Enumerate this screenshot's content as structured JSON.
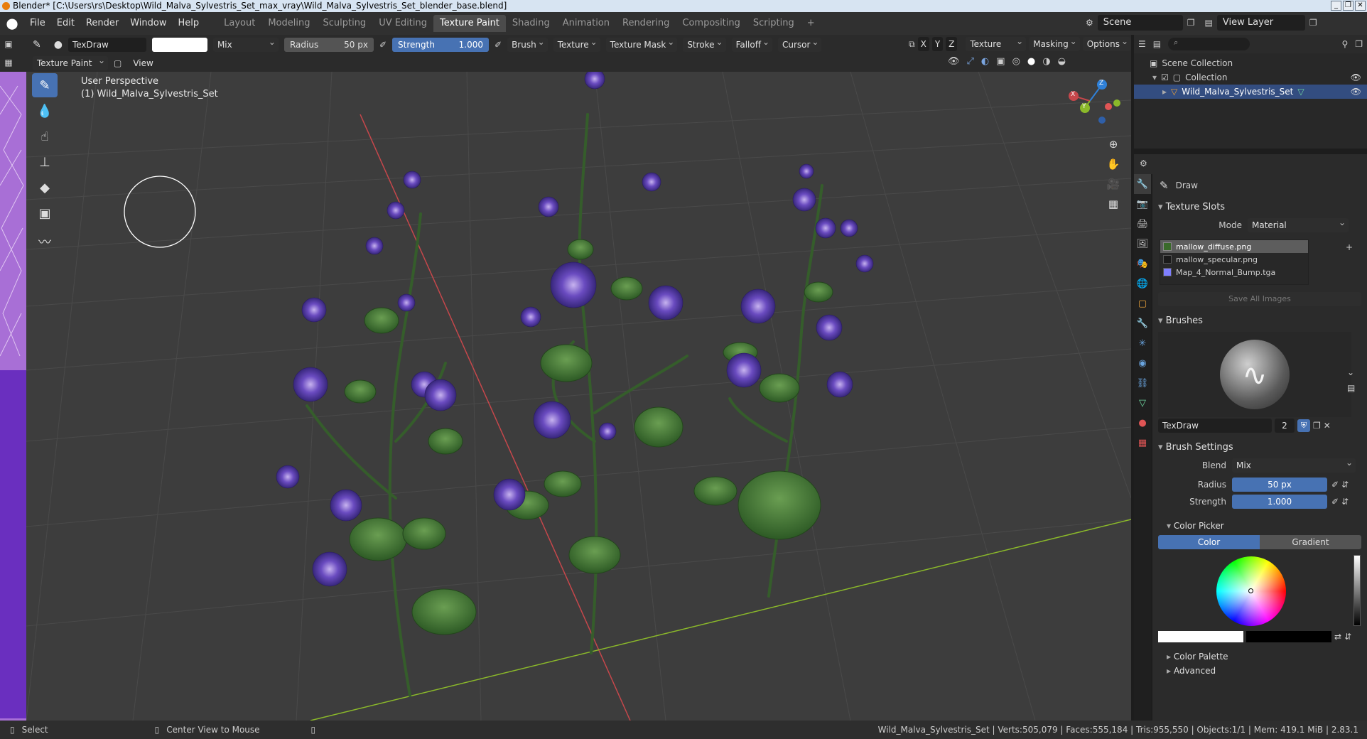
{
  "window": {
    "title": "Blender* [C:\\Users\\rs\\Desktop\\Wild_Malva_Sylvestris_Set_max_vray\\Wild_Malva_Sylvestris_Set_blender_base.blend]",
    "controls": [
      "_",
      "❐",
      "✕"
    ]
  },
  "menu": {
    "items": [
      "File",
      "Edit",
      "Render",
      "Window",
      "Help"
    ]
  },
  "workspaces": {
    "tabs": [
      "Layout",
      "Modeling",
      "Sculpting",
      "UV Editing",
      "Texture Paint",
      "Shading",
      "Animation",
      "Rendering",
      "Compositing",
      "Scripting"
    ],
    "active": "Texture Paint",
    "add": "+"
  },
  "topright": {
    "scene": "Scene",
    "view_layer": "View Layer"
  },
  "tool_header": {
    "brush_name": "TexDraw",
    "blend": "Mix",
    "radius_label": "Radius",
    "radius_value": "50 px",
    "strength_label": "Strength",
    "strength_value": "1.000",
    "menus": [
      "Brush",
      "Texture",
      "Texture Mask",
      "Stroke",
      "Falloff",
      "Cursor"
    ],
    "axes": [
      "X",
      "Y",
      "Z"
    ],
    "right_menus": [
      "Texture Slots",
      "Masking",
      "Options"
    ]
  },
  "view_header": {
    "mode": "Texture Paint",
    "view": "View"
  },
  "viewport": {
    "perspective": "User Perspective",
    "object": "(1) Wild_Malva_Sylvestris_Set",
    "gizmo_axes": [
      "X",
      "Y",
      "Z"
    ]
  },
  "outliner": {
    "root": "Scene Collection",
    "collection": "Collection",
    "object": "Wild_Malva_Sylvestris_Set"
  },
  "properties": {
    "tool_name": "Draw",
    "texture_slots": {
      "title": "Texture Slots",
      "mode_label": "Mode",
      "mode_value": "Material",
      "slots": [
        "mallow_diffuse.png",
        "mallow_specular.png",
        "Map_4_Normal_Bump.tga"
      ],
      "save_all": "Save All Images"
    },
    "brushes": {
      "title": "Brushes",
      "brush_name": "TexDraw",
      "users": "2"
    },
    "brush_settings": {
      "title": "Brush Settings",
      "blend_label": "Blend",
      "blend_value": "Mix",
      "radius_label": "Radius",
      "radius_value": "50 px",
      "strength_label": "Strength",
      "strength_value": "1.000"
    },
    "color_picker": {
      "title": "Color Picker",
      "tab_color": "Color",
      "tab_gradient": "Gradient"
    },
    "color_palette": "Color Palette",
    "advanced": "Advanced"
  },
  "statusbar": {
    "select": "Select",
    "center_view": "Center View to Mouse",
    "stats": "Wild_Malva_Sylvestris_Set | Verts:505,079 | Faces:555,184 | Tris:955,550 | Objects:1/1 | Mem: 419.1 MiB | 2.83.1"
  },
  "colors": {
    "accent": "#4772b3",
    "viewport_bg": "#3d3d3d",
    "x_axis": "#c6474b",
    "y_axis": "#8bb92a",
    "z_axis": "#2f81d9",
    "flower": "#5a3ea8",
    "leaf": "#3f7a32"
  }
}
